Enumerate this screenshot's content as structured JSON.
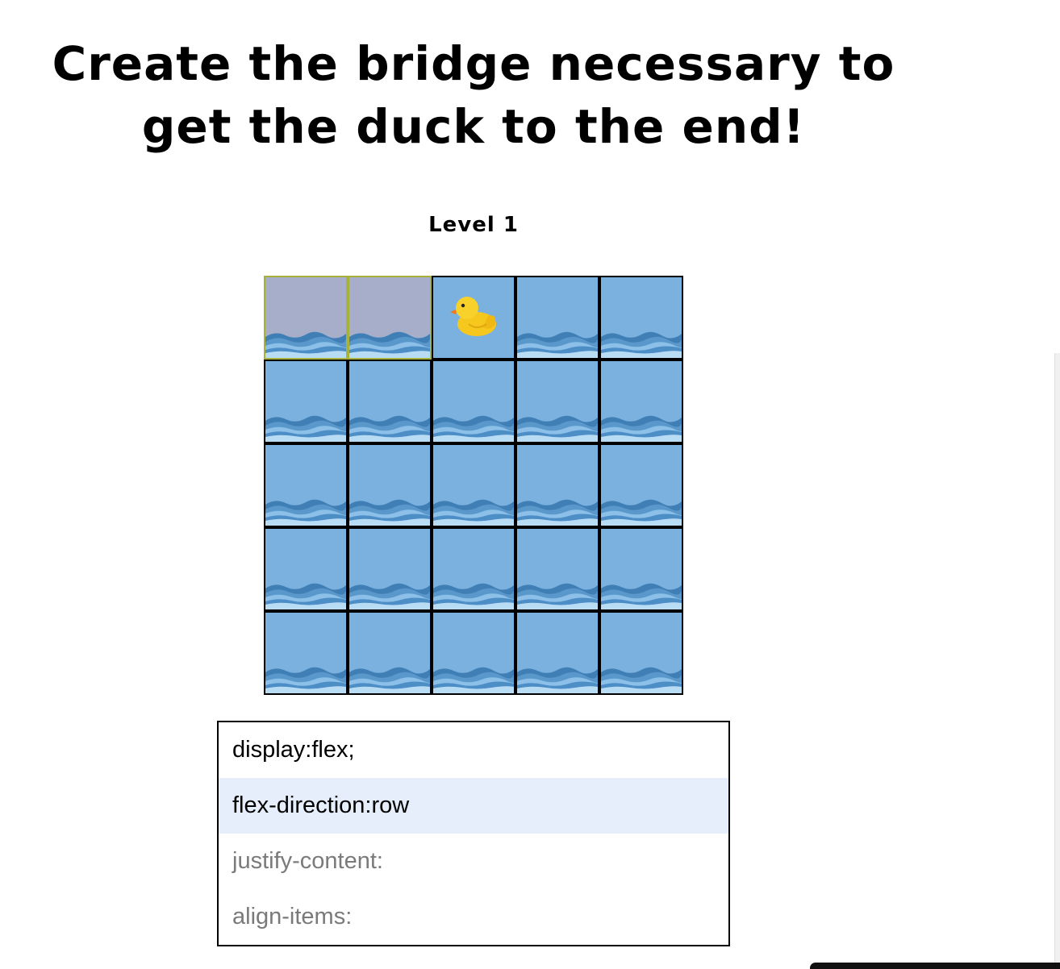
{
  "title": "Create the bridge necessary to get the duck to the end!",
  "level_label": "Level 1",
  "board": {
    "rows": 5,
    "cols": 5,
    "bridge_tiles": [
      [
        0,
        0
      ],
      [
        0,
        1
      ]
    ],
    "duck_tile": [
      0,
      2
    ],
    "colors": {
      "water": "#7ab1df",
      "bridge": "#a6aec9",
      "bridge_border": "#a8b23a",
      "grid_border": "#000000"
    },
    "icons": {
      "water": "water-waves-icon",
      "duck": "rubber-duck-icon"
    }
  },
  "css_panel": {
    "selected_index": 1,
    "rows": [
      {
        "text": "display:flex;",
        "kind": "filled"
      },
      {
        "text": "flex-direction:row",
        "kind": "filled"
      },
      {
        "text": "justify-content:",
        "kind": "placeholder"
      },
      {
        "text": "align-items:",
        "kind": "placeholder"
      }
    ]
  }
}
